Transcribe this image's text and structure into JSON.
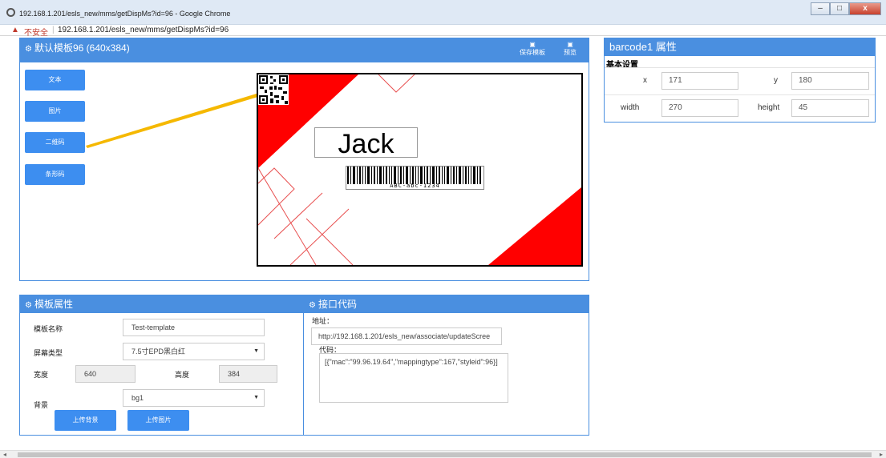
{
  "window": {
    "title": "192.168.1.201/esls_new/mms/getDispMs?id=96 - Google Chrome",
    "minimize": "–",
    "maximize": "□",
    "close": "x"
  },
  "address": {
    "insecure_label": "不安全",
    "url": "192.168.1.201/esls_new/mms/getDispMs?id=96"
  },
  "designer": {
    "title": "默认模板96 (640x384)",
    "save_label": "保存模板",
    "preview_label": "预览",
    "side_buttons": [
      "文本",
      "图片",
      "二维码",
      "条形码"
    ],
    "canvas": {
      "text_item": "Jack",
      "barcode_text": "ABC-abc-1234"
    }
  },
  "properties": {
    "title": "barcode1 属性",
    "section": "基本设置",
    "x_label": "x",
    "x_value": "171",
    "y_label": "y",
    "y_value": "180",
    "width_label": "width",
    "width_value": "270",
    "height_label": "height",
    "height_value": "45"
  },
  "template_props": {
    "title": "模板属性",
    "name_label": "模板名称",
    "name_value": "Test-template",
    "screen_label": "屏幕类型",
    "screen_value": "7.5寸EPD黑白红",
    "width_label": "宽度",
    "width_value": "640",
    "height_label": "高度",
    "height_value": "384",
    "bg_label": "背景",
    "bg_value": "bg1",
    "upload_bg_label": "上传背景",
    "upload_img_label": "上传图片"
  },
  "api": {
    "title": "接口代码",
    "address_label": "地址：",
    "address_value": "http://192.168.1.201/esls_new/associate/updateScree",
    "code_label": "代码：",
    "code_value": "[{\"mac\":\"99.96.19.64\",\"mappingtype\":167,\"styleid\":96}]"
  },
  "colors": {
    "accent": "#4a8fe0",
    "button": "#3d8ef0",
    "canvas_red": "#ff0000",
    "pointer_arrow": "#f5b800"
  }
}
